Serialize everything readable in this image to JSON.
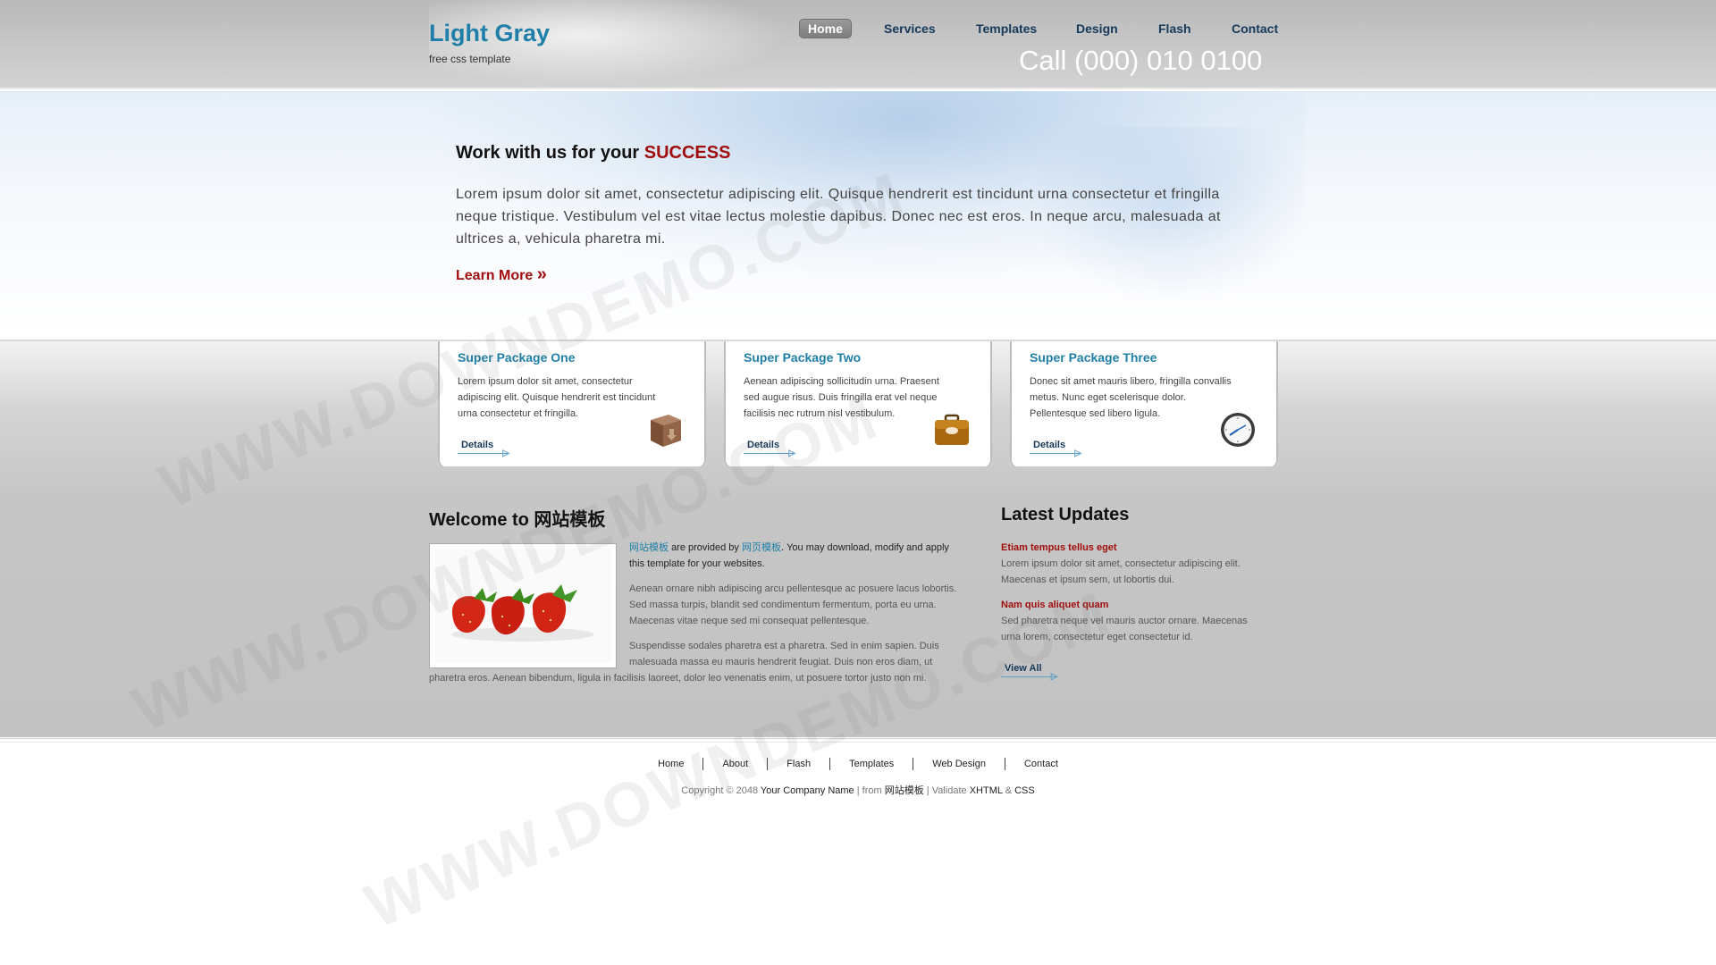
{
  "header": {
    "site_title": "Light Gray",
    "tagline": "free css template",
    "phone": "Call (000) 010 0100",
    "nav": [
      {
        "label": "Home",
        "active": true
      },
      {
        "label": "Services",
        "active": false
      },
      {
        "label": "Templates",
        "active": false
      },
      {
        "label": "Design",
        "active": false
      },
      {
        "label": "Flash",
        "active": false
      },
      {
        "label": "Contact",
        "active": false
      }
    ]
  },
  "hero": {
    "heading_prefix": "Work with us for your",
    "heading_accent": "SUCCESS",
    "text": "Lorem ipsum dolor sit amet, consectetur adipiscing elit. Quisque hendrerit est tincidunt urna consectetur et fringilla neque tristique. Vestibulum vel est vitae lectus molestie dapibus. Donec nec est eros. In neque arcu, malesuada at ultrices a, vehicula pharetra mi.",
    "learn_more": "Learn More",
    "learn_more_glyph": "»"
  },
  "packages": [
    {
      "title": "Super Package One",
      "text": "Lorem ipsum dolor sit amet, consectetur adipiscing elit. Quisque hendrerit est tincidunt urna consectetur et fringilla.",
      "link": "Details",
      "icon": "box-icon"
    },
    {
      "title": "Super Package Two",
      "text": "Aenean adipiscing sollicitudin urna. Praesent sed augue risus. Duis fringilla erat vel neque facilisis nec rutrum nisl vestibulum.",
      "link": "Details",
      "icon": "briefcase-icon"
    },
    {
      "title": "Super Package Three",
      "text": "Donec sit amet mauris libero, fringilla convallis metus. Nunc eget scelerisque dolor. Pellentesque sed libero ligula.",
      "link": "Details",
      "icon": "clock-icon"
    }
  ],
  "welcome": {
    "title": "Welcome to 网站模板",
    "p1_link1": "网站模板",
    "p1_mid": "are provided by",
    "p1_link2": "网页模板",
    "p1_end": ". You may download, modify and apply this template for your websites.",
    "p2": "Aenean ornare nibh adipiscing arcu pellentesque ac posuere lacus lobortis. Sed massa turpis, blandit sed condimentum fermentum, porta eu urna. Maecenas vitae neque sed mi consequat pellentesque.",
    "p3": "Suspendisse sodales pharetra est a pharetra. Sed in enim sapien. Duis malesuada massa eu mauris hendrerit feugiat. Duis non eros diam, ut pharetra eros. Aenean bibendum, ligula in facilisis laoreet, dolor leo venenatis enim, ut posuere tortor justo non mi."
  },
  "updates": {
    "title": "Latest Updates",
    "items": [
      {
        "heading": "Etiam tempus tellus eget",
        "body": "Lorem ipsum dolor sit amet, consectetur adipiscing elit. Maecenas et ipsum sem, ut lobortis dui."
      },
      {
        "heading": "Nam quis aliquet quam",
        "body": "Sed pharetra neque vel mauris auctor ornare. Maecenas urna lorem, consectetur eget consectetur id."
      }
    ],
    "view_all": "View All"
  },
  "footer": {
    "nav": [
      "Home",
      "About",
      "Flash",
      "Templates",
      "Web Design",
      "Contact"
    ],
    "copyright_prefix": "Copyright © 2048",
    "company": "Your Company Name",
    "from_text": "| from",
    "from_link": "网站模板",
    "validate_text": "| Validate",
    "xhtml": "XHTML",
    "amp": "&",
    "css": "CSS"
  },
  "watermark": "WWW.DOWNDEMO.COM",
  "colors": {
    "accent_blue": "#1f7fa8",
    "accent_red": "#a10d0d",
    "nav_blue": "#16385a"
  }
}
